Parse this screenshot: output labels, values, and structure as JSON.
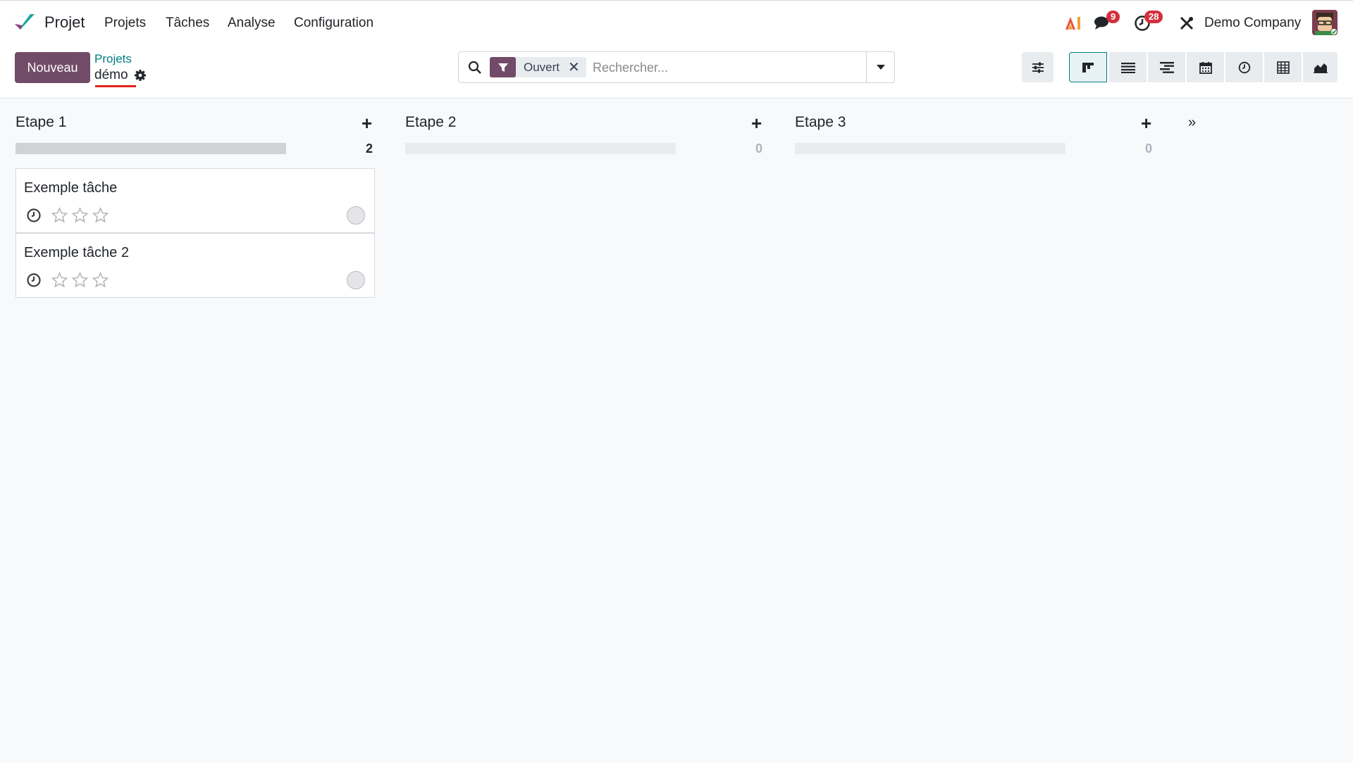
{
  "navbar": {
    "app_name": "Projet",
    "menu": [
      "Projets",
      "Tâches",
      "Analyse",
      "Configuration"
    ],
    "messages_count": "9",
    "activities_count": "28",
    "company": "Demo Company"
  },
  "control": {
    "new_label": "Nouveau",
    "breadcrumb_parent": "Projets",
    "breadcrumb_current": "démo",
    "facet_label": "Ouvert",
    "search_placeholder": "Rechercher..."
  },
  "views": [
    "kanban",
    "list",
    "gantt",
    "calendar",
    "activity",
    "pivot",
    "graph"
  ],
  "stages": [
    {
      "name": "Etape 1",
      "count": "2",
      "progress": 1.0
    },
    {
      "name": "Etape 2",
      "count": "0",
      "progress": 0
    },
    {
      "name": "Etape 3",
      "count": "0",
      "progress": 0
    }
  ],
  "tasks": [
    {
      "title": "Exemple tâche",
      "stars": 0
    },
    {
      "title": "Exemple tâche 2",
      "stars": 0
    }
  ],
  "colors": {
    "primary": "#714b67",
    "secondary": "#017e84",
    "badge": "#d52f3d"
  }
}
